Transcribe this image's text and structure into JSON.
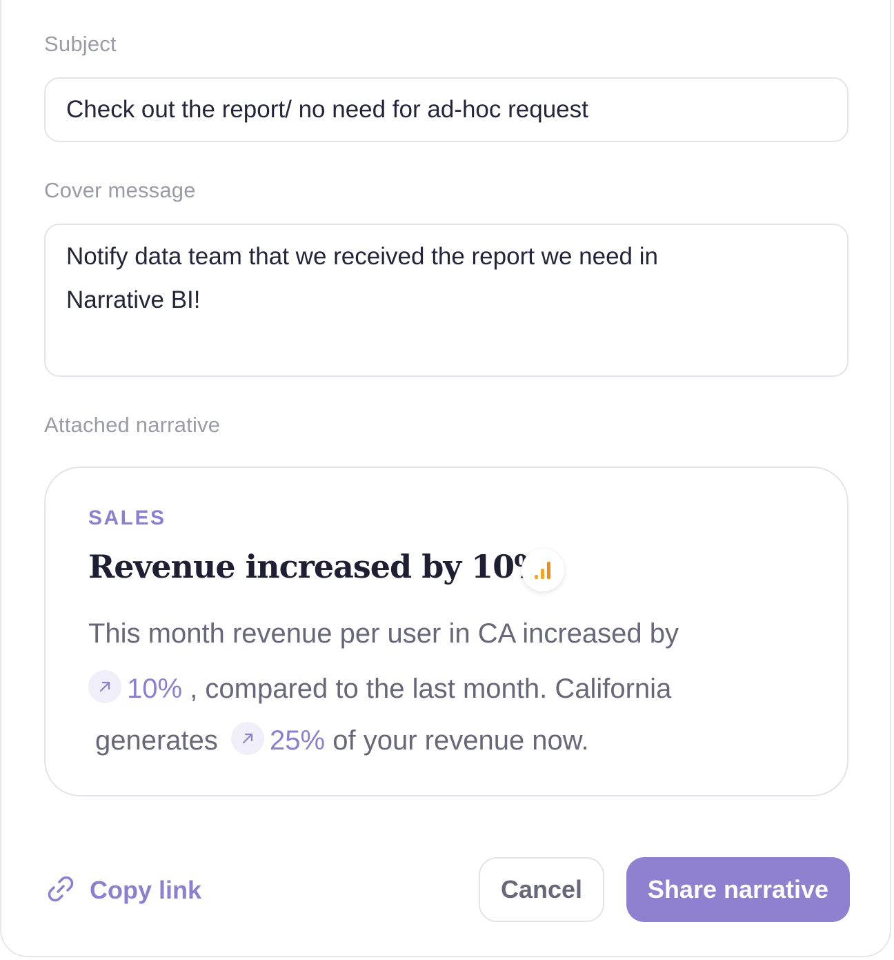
{
  "form": {
    "subject_label": "Subject",
    "subject_value": "Check out the report/ no need for ad-hoc request",
    "cover_label": "Cover message",
    "cover_value_line1": "Notify data team that we received the report we need in",
    "cover_value_line2": "Narrative BI!",
    "attached_label": "Attached narrative"
  },
  "narrative": {
    "category": "SALES",
    "headline": "Revenue increased by 10%",
    "badge_icon": "bar-chart-icon",
    "body_line1": "This month revenue per user in CA increased by",
    "pct1": "10%",
    "body_line2_rest": ", compared to the last month. California",
    "body_line3_start": "generates",
    "pct2": "25%",
    "body_line3_rest": "of your revenue now."
  },
  "actions": {
    "copy_link": "Copy link",
    "cancel": "Cancel",
    "share": "Share narrative"
  },
  "colors": {
    "accent": "#8f80d0",
    "chart_orange": "#f5a623"
  }
}
